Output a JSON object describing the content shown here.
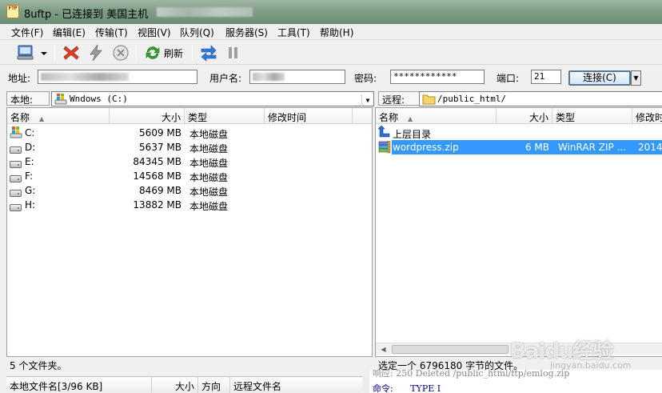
{
  "window": {
    "title": "8uftp - 已连接到 美国主机",
    "app_icon_text": "FTP"
  },
  "menu": [
    {
      "label": "文件(F)"
    },
    {
      "label": "编辑(E)"
    },
    {
      "label": "传输(T)"
    },
    {
      "label": "视图(V)"
    },
    {
      "label": "队列(Q)"
    },
    {
      "label": "服务器(S)"
    },
    {
      "label": "工具(T)"
    },
    {
      "label": "帮助(H)"
    }
  ],
  "toolbar": {
    "refresh_label": "刷新"
  },
  "connection": {
    "address_label": "地址:",
    "username_label": "用户名:",
    "password_label": "密码:",
    "password_value": "************",
    "port_label": "端口:",
    "port_value": "21",
    "connect_label": "连接(C)"
  },
  "local": {
    "label": "本地:",
    "path": "Wndows (C:)",
    "columns": {
      "name": "名称",
      "size": "大小",
      "type": "类型",
      "modified": "修改时间"
    },
    "rows": [
      {
        "name": "C:",
        "size": "5609 MB",
        "type": "本地磁盘",
        "icon": "windows-drive-icon"
      },
      {
        "name": "D:",
        "size": "5637 MB",
        "type": "本地磁盘",
        "icon": "drive-icon"
      },
      {
        "name": "E:",
        "size": "84345 MB",
        "type": "本地磁盘",
        "icon": "drive-icon"
      },
      {
        "name": "F:",
        "size": "14568 MB",
        "type": "本地磁盘",
        "icon": "drive-icon"
      },
      {
        "name": "G:",
        "size": "8469 MB",
        "type": "本地磁盘",
        "icon": "drive-icon"
      },
      {
        "name": "H:",
        "size": "13882 MB",
        "type": "本地磁盘",
        "icon": "drive-icon"
      }
    ],
    "status": "5 个文件夹。"
  },
  "remote": {
    "label": "远程:",
    "path": "/public_html/",
    "columns": {
      "name": "名称",
      "size": "大小",
      "type": "类型",
      "modified": "修改时"
    },
    "rows": [
      {
        "name": "上层目录",
        "size": "",
        "type": "",
        "modified": "",
        "icon": "up-folder-icon"
      },
      {
        "name": "wordpress.zip",
        "size": "6 MB",
        "type": "WinRAR ZIP ...",
        "modified": "2014-",
        "icon": "zip-archive-icon"
      }
    ],
    "status": "选定一个 6796180 字节的文件。"
  },
  "queue": {
    "columns": {
      "local_file": "本地文件名[3/96 KB]",
      "size": "大小",
      "direction": "方向",
      "remote_file": "远程文件名"
    }
  },
  "log": {
    "line1": "响应:   250 Deleted /public_html/ftp/emlog.zip",
    "line2_label": "命令:",
    "line2_value": "TYPE I"
  },
  "watermark": {
    "text": "Baidu经验",
    "sub": "jingyan.baidu.com"
  },
  "colors": {
    "selection": "#3399ff",
    "title_bar": "#7f9d86"
  }
}
